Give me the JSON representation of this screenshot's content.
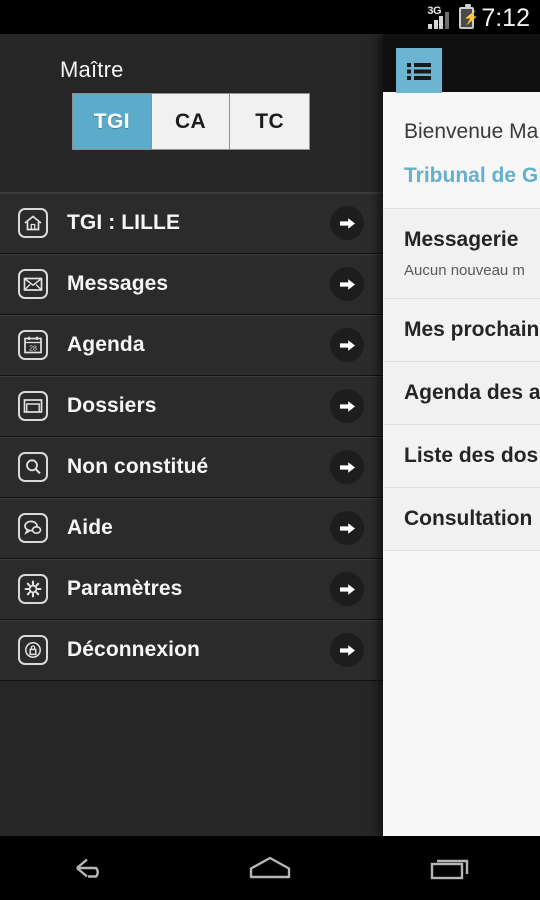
{
  "statusbar": {
    "network_label": "3G",
    "time": "7:12",
    "battery_icon": "battery-charging-icon",
    "signal_icon": "signal-bars-icon"
  },
  "drawer": {
    "title": "Maître",
    "segmented": {
      "options": [
        {
          "label": "TGI",
          "selected": true
        },
        {
          "label": "CA",
          "selected": false
        },
        {
          "label": "TC",
          "selected": false
        }
      ],
      "selected_value": "TGI"
    },
    "items": [
      {
        "label": "TGI : LILLE",
        "icon": "home-icon"
      },
      {
        "label": "Messages",
        "icon": "mail-icon"
      },
      {
        "label": "Agenda",
        "icon": "calendar-icon",
        "icon_text": "28"
      },
      {
        "label": "Dossiers",
        "icon": "folder-icon"
      },
      {
        "label": "Non constitué",
        "icon": "search-icon"
      },
      {
        "label": "Aide",
        "icon": "chat-bubbles-icon"
      },
      {
        "label": "Paramètres",
        "icon": "gear-icon"
      },
      {
        "label": "Déconnexion",
        "icon": "lock-icon"
      }
    ]
  },
  "content": {
    "toggle_icon": "list-menu-icon",
    "welcome": "Bienvenue Ma",
    "tribunal": "Tribunal de G",
    "rows": [
      {
        "title": "Messagerie",
        "subtitle": "Aucun nouveau m"
      },
      {
        "title": "Mes prochain",
        "subtitle": ""
      },
      {
        "title": "Agenda des a",
        "subtitle": ""
      },
      {
        "title": "Liste des dos",
        "subtitle": ""
      },
      {
        "title": "Consultation",
        "subtitle": ""
      }
    ]
  },
  "navbar": {
    "back": "back-icon",
    "home": "home-icon",
    "recents": "recents-icon"
  },
  "colors": {
    "accent": "#5cabca",
    "toggle_bg": "#6cb4d2",
    "drawer_bg": "#2b2b2b",
    "panel_bg": "#f1f1f1"
  }
}
